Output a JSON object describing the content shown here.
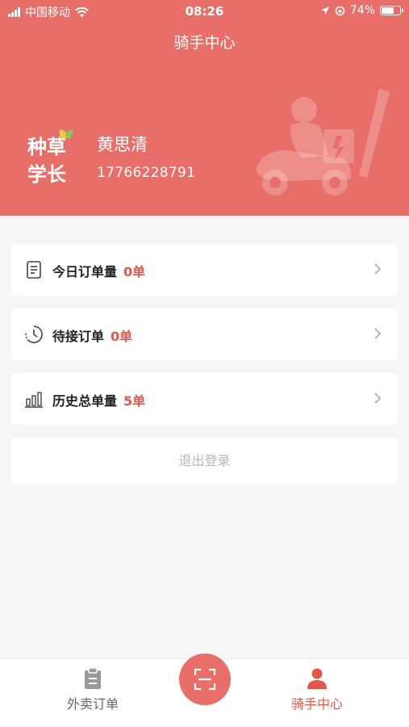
{
  "status_bar": {
    "carrier": "中国移动",
    "time": "08:26",
    "battery": "74%",
    "battery_level": 0.74
  },
  "header": {
    "title": "骑手中心",
    "logo_text": [
      "种草",
      "学长"
    ],
    "user_name": "黄思清",
    "user_phone": "17766228791"
  },
  "stats": [
    {
      "label": "今日订单量",
      "count": "0单",
      "icon": "document-icon"
    },
    {
      "label": "待接订单",
      "count": "0单",
      "icon": "clock-icon"
    },
    {
      "label": "历史总单量",
      "count": "5单",
      "icon": "bar-chart-icon"
    }
  ],
  "logout_label": "退出登录",
  "tabbar": {
    "orders_label": "外卖订单",
    "rider_label": "骑手中心",
    "scan_icon": "scan-icon"
  },
  "colors": {
    "brand": "#e86f69",
    "accent_text": "#e2574c",
    "background": "#f6f6f6"
  }
}
